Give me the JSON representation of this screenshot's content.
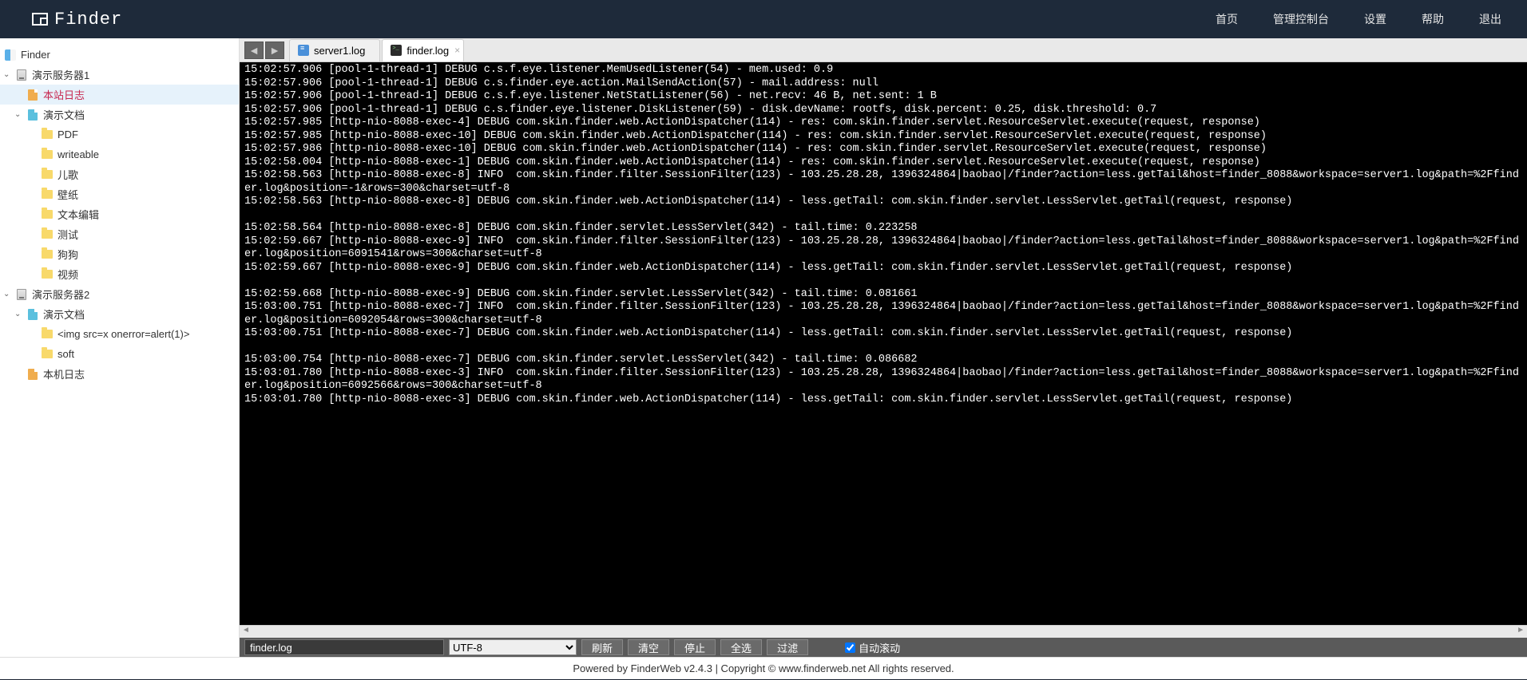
{
  "app": {
    "name": "Finder"
  },
  "nav": [
    {
      "label": "首页"
    },
    {
      "label": "管理控制台"
    },
    {
      "label": "设置"
    },
    {
      "label": "帮助"
    },
    {
      "label": "退出"
    }
  ],
  "tree": {
    "root_label": "Finder",
    "server1": {
      "label": "演示服务器1",
      "site_log": "本站日志",
      "docs": {
        "label": "演示文档",
        "children": [
          "PDF",
          "writeable",
          "儿歌",
          "壁纸",
          "文本编辑",
          "测试",
          "狗狗",
          "视频"
        ]
      }
    },
    "server2": {
      "label": "演示服务器2",
      "docs": {
        "label": "演示文档",
        "children": [
          "<img src=x onerror=alert(1)>",
          "soft"
        ]
      },
      "local_log": "本机日志"
    }
  },
  "tabs": [
    {
      "label": "server1.log",
      "active": false
    },
    {
      "label": "finder.log",
      "active": true
    }
  ],
  "console_lines": [
    "15:02:57.906 [pool-1-thread-1] DEBUG c.s.f.eye.listener.MemUsedListener(54) - mem.used: 0.9",
    "15:02:57.906 [pool-1-thread-1] DEBUG c.s.finder.eye.action.MailSendAction(57) - mail.address: null",
    "15:02:57.906 [pool-1-thread-1] DEBUG c.s.f.eye.listener.NetStatListener(56) - net.recv: 46 B, net.sent: 1 B",
    "15:02:57.906 [pool-1-thread-1] DEBUG c.s.finder.eye.listener.DiskListener(59) - disk.devName: rootfs, disk.percent: 0.25, disk.threshold: 0.7",
    "15:02:57.985 [http-nio-8088-exec-4] DEBUG com.skin.finder.web.ActionDispatcher(114) - res: com.skin.finder.servlet.ResourceServlet.execute(request, response)",
    "15:02:57.985 [http-nio-8088-exec-10] DEBUG com.skin.finder.web.ActionDispatcher(114) - res: com.skin.finder.servlet.ResourceServlet.execute(request, response)",
    "15:02:57.986 [http-nio-8088-exec-10] DEBUG com.skin.finder.web.ActionDispatcher(114) - res: com.skin.finder.servlet.ResourceServlet.execute(request, response)",
    "15:02:58.004 [http-nio-8088-exec-1] DEBUG com.skin.finder.web.ActionDispatcher(114) - res: com.skin.finder.servlet.ResourceServlet.execute(request, response)",
    "15:02:58.563 [http-nio-8088-exec-8] INFO  com.skin.finder.filter.SessionFilter(123) - 103.25.28.28, 1396324864|baobao|/finder?action=less.getTail&host=finder_8088&workspace=server1.log&path=%2Ffinder.log&position=-1&rows=300&charset=utf-8",
    "15:02:58.563 [http-nio-8088-exec-8] DEBUG com.skin.finder.web.ActionDispatcher(114) - less.getTail: com.skin.finder.servlet.LessServlet.getTail(request, response)",
    "",
    "15:02:58.564 [http-nio-8088-exec-8] DEBUG com.skin.finder.servlet.LessServlet(342) - tail.time: 0.223258",
    "15:02:59.667 [http-nio-8088-exec-9] INFO  com.skin.finder.filter.SessionFilter(123) - 103.25.28.28, 1396324864|baobao|/finder?action=less.getTail&host=finder_8088&workspace=server1.log&path=%2Ffinder.log&position=6091541&rows=300&charset=utf-8",
    "15:02:59.667 [http-nio-8088-exec-9] DEBUG com.skin.finder.web.ActionDispatcher(114) - less.getTail: com.skin.finder.servlet.LessServlet.getTail(request, response)",
    "",
    "15:02:59.668 [http-nio-8088-exec-9] DEBUG com.skin.finder.servlet.LessServlet(342) - tail.time: 0.081661",
    "15:03:00.751 [http-nio-8088-exec-7] INFO  com.skin.finder.filter.SessionFilter(123) - 103.25.28.28, 1396324864|baobao|/finder?action=less.getTail&host=finder_8088&workspace=server1.log&path=%2Ffinder.log&position=6092054&rows=300&charset=utf-8",
    "15:03:00.751 [http-nio-8088-exec-7] DEBUG com.skin.finder.web.ActionDispatcher(114) - less.getTail: com.skin.finder.servlet.LessServlet.getTail(request, response)",
    "",
    "15:03:00.754 [http-nio-8088-exec-7] DEBUG com.skin.finder.servlet.LessServlet(342) - tail.time: 0.086682",
    "15:03:01.780 [http-nio-8088-exec-3] INFO  com.skin.finder.filter.SessionFilter(123) - 103.25.28.28, 1396324864|baobao|/finder?action=less.getTail&host=finder_8088&workspace=server1.log&path=%2Ffinder.log&position=6092566&rows=300&charset=utf-8",
    "15:03:01.780 [http-nio-8088-exec-3] DEBUG com.skin.finder.web.ActionDispatcher(114) - less.getTail: com.skin.finder.servlet.LessServlet.getTail(request, response)",
    ""
  ],
  "toolbar": {
    "filename": "finder.log",
    "charset": "UTF-8",
    "refresh": "刷新",
    "clear": "清空",
    "stop": "停止",
    "select_all": "全选",
    "filter": "过滤",
    "auto_scroll": "自动滚动"
  },
  "footer": "Powered by FinderWeb v2.4.3 | Copyright © www.finderweb.net All rights reserved."
}
